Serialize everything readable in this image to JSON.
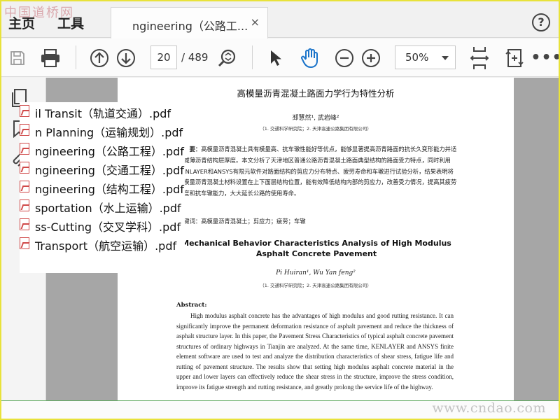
{
  "watermarks": {
    "top_left": "中国道桥网",
    "bottom_right": "www.cndao.com"
  },
  "menu": {
    "home": "主页",
    "tools": "工具"
  },
  "tab": {
    "label": "ngineering（公路工...",
    "close": "×"
  },
  "help": {
    "glyph": "?"
  },
  "toolbar": {
    "current_page": "20",
    "total_pages": "/ 489",
    "zoom": "50%",
    "more": "•••",
    "icons": [
      "save-icon",
      "print-icon",
      "prev-page-icon",
      "next-page-icon",
      "zoom-search-icon",
      "select-pointer-icon",
      "hand-tool-icon",
      "zoom-out-icon",
      "zoom-in-icon",
      "fit-page-icon",
      "rotate-icon",
      "more-icon"
    ]
  },
  "left_panel": {
    "icons": [
      "pages-icon",
      "bookmark-icon",
      "attachment-icon"
    ]
  },
  "file_list": [
    "il Transit（轨道交通）.pdf",
    "n Planning（运输规划）.pdf",
    "ngineering（公路工程）.pdf",
    "ngineering（交通工程）.pdf",
    "ngineering（结构工程）.pdf",
    "sportation（水上运输）.pdf",
    "ss-Cutting（交叉学科）.pdf",
    "Transport（航空运输）.pdf"
  ],
  "pdf_page": {
    "title_cn": "高模量沥青混凝土路面力学行为特性分析",
    "authors_cn": "邳慧然¹, 武岩峰²",
    "affiliation_cn": "（1. 交通科学研究院；2. 天津高速公路集团有限公司）",
    "abstract_cn_label": "摘　要：",
    "abstract_cn": "高模量沥青混凝土具有模量高、抗车辙性能好等优点，能够显著提高沥青路面的抗长久变形能力并适当减薄沥青结构层厚度。本文分析了天津地区普通公路沥青混凝土路面典型结构的路面受力特点，同时利用KENLAYER和ANSYS有限元软件对路面结构的剪应力分布特点、疲劳寿命和车辙进行试验分析，结果表明将高模量沥青混凝土材料设置在上下面层结构位置，能有效降低结构内部的剪应力，改善受力情况，提高其疲劳强度和抗车辙能力，大大延长公路的使用寿命。",
    "keywords_cn": "关键词：高模量沥青混凝土；剪应力；疲劳；车辙",
    "title_en": "Mechanical Behavior Characteristics Analysis of High Modulus Asphalt Concrete Pavement",
    "authors_en": "Pi Huiran¹, Wu Yan feng²",
    "affiliation_en": "（1. 交通科学研究院；2. 天津高速公路集团有限公司）",
    "abstract_en_label": "Abstract:",
    "abstract_en": "High modulus asphalt concrete has the advantages of high modulus and good rutting resistance. It can significantly improve the permanent deformation resistance of asphalt pavement and reduce the thickness of asphalt structure layer. In this paper, the Pavement Stress Characteristics of typical asphalt concrete pavement structures of ordinary highways in Tianjin are analyzed. At the same time, KENLAYER and ANSYS finite element software are used to test and analyze the distribution characteristics of shear stress, fatigue life and rutting of pavement structure. The results show that setting high modulus asphalt concrete material in the upper and lower layers can effectively reduce the shear stress in the structure, improve the stress condition, improve its fatigue strength and rutting resistance, and greatly prolong the service life of the highway."
  },
  "colors": {
    "border": "#e8e23a",
    "accent": "#1a73c9",
    "pdf_red": "#d04a4a",
    "gutter": "#a6a6a6"
  }
}
